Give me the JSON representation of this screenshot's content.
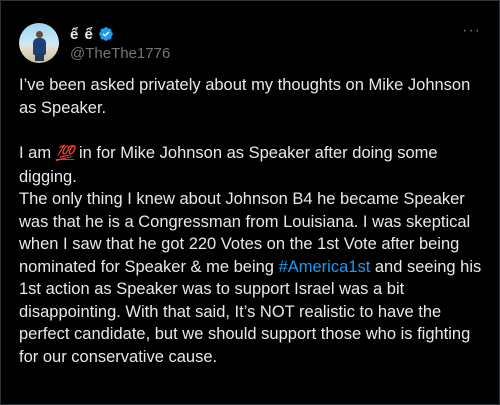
{
  "author": {
    "display_name": "ể ể",
    "handle": "@TheThe1776",
    "verified_icon": "verified-badge-icon",
    "verified_color": "#1d9bf0"
  },
  "menu": {
    "more_glyph": "···"
  },
  "tweet": {
    "line1": "I’ve been asked privately about my thoughts on Mike Johnson as Speaker.",
    "line2_before": "I am ",
    "line2_emoji": "💯",
    "line2_after": " in for Mike Johnson as Speaker after doing some digging.",
    "line3_before": "The only thing I knew about Johnson B4 he became Speaker was that he is a Congressman from Louisiana. I was skeptical when I saw that he got 220 Votes on the 1st Vote after being nominated for Speaker & me being ",
    "hashtag": "#America1st",
    "line3_after": " and seeing his 1st action as Speaker was to support Israel was a bit disappointing. With that said, It’s NOT realistic to have the perfect candidate, but we should support those who is fighting for our conservative cause."
  },
  "colors": {
    "background": "#000000",
    "text": "#e7e9ea",
    "secondary": "#71767b",
    "link": "#1d9bf0"
  }
}
